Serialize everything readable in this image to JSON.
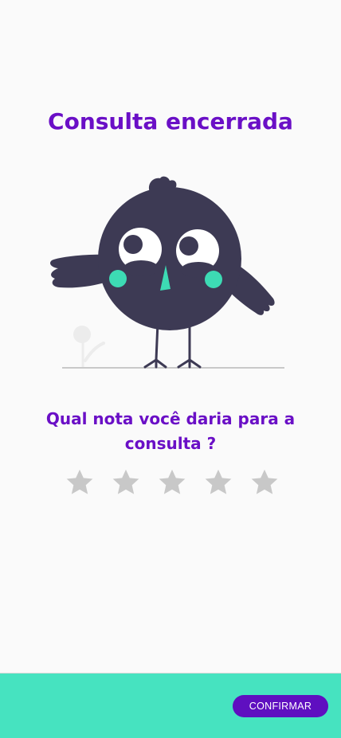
{
  "screen": {
    "title": "Consulta encerrada",
    "question": "Qual nota você daria para a consulta ?"
  },
  "rating": {
    "max_stars": 5,
    "selected": 0,
    "star_icon": "star-icon",
    "empty_color": "#c8c8c8"
  },
  "footer": {
    "confirm_label": "CONFIRMAR",
    "background_color": "#46e3c0",
    "button_color": "#5f0fc0"
  },
  "colors": {
    "accent": "#6a0fc6",
    "bird_body": "#3d3a54",
    "bird_cheeks": "#3ddbb4"
  }
}
